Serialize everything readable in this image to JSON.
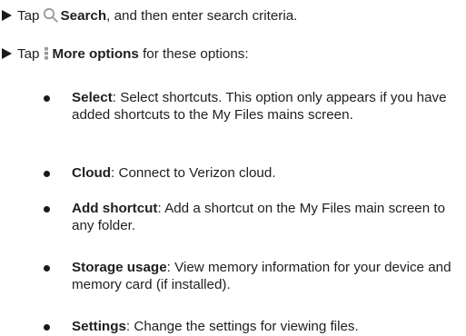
{
  "steps": [
    {
      "prefix": "Tap",
      "icon": "search-icon",
      "label": "Search",
      "suffix": ", and then enter search criteria."
    },
    {
      "prefix": "Tap",
      "icon": "more-options-icon",
      "label": "More options",
      "suffix": " for these options:"
    }
  ],
  "options": [
    {
      "term": "Select",
      "desc": ": Select shortcuts. This option only appears if you have added shortcuts to the My Files mains screen."
    },
    {
      "term": "Cloud",
      "desc": ": Connect to Verizon cloud."
    },
    {
      "term": "Add shortcut",
      "desc": ": Add a shortcut on the My Files main screen to any folder."
    },
    {
      "term": "Storage usage",
      "desc": ": View memory information for your device and memory card (if installed)."
    },
    {
      "term": "Settings",
      "desc": ": Change the settings for viewing files."
    }
  ],
  "colors": {
    "text": "#1f1f1f",
    "icon": "#9a9a9a"
  }
}
